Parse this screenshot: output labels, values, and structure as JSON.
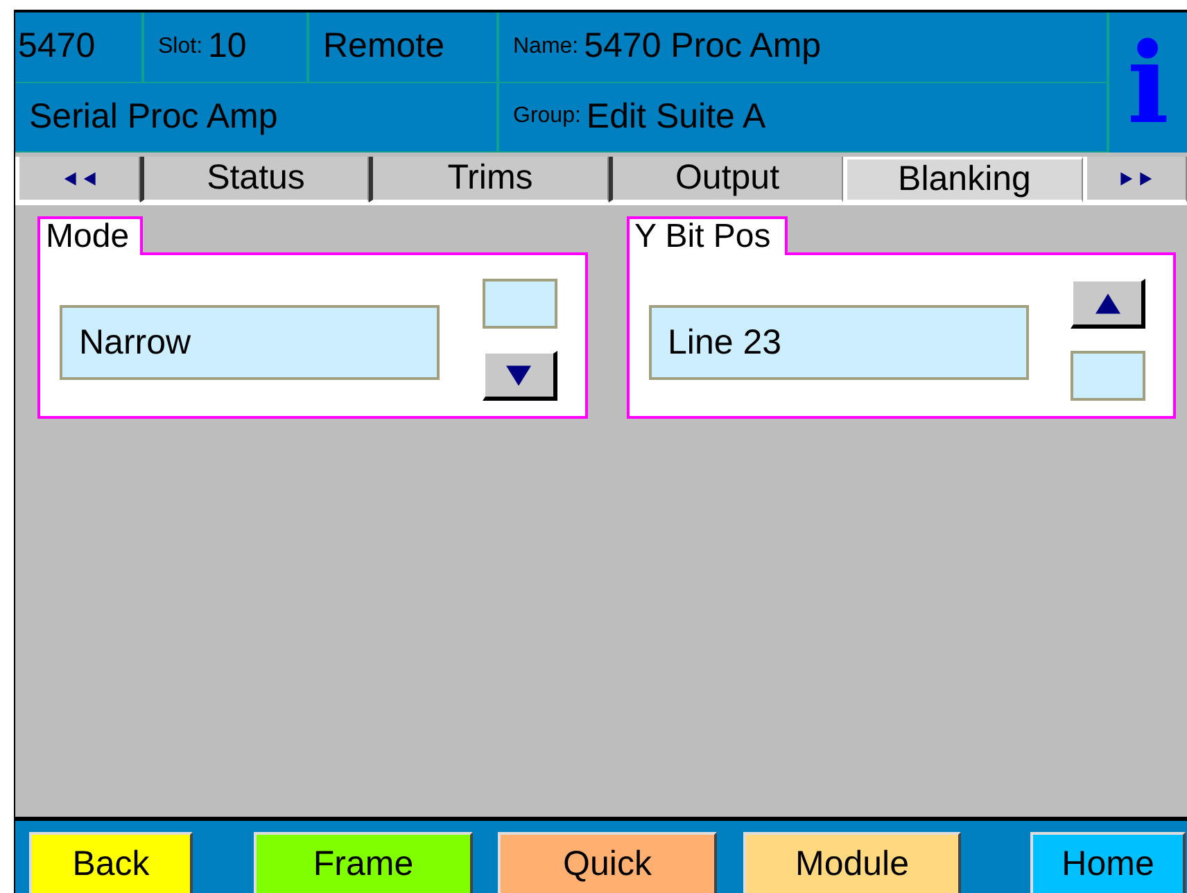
{
  "header": {
    "model": "5470",
    "slot_label": "Slot:",
    "slot": "10",
    "mode": "Remote",
    "name_label": "Name:",
    "name": "5470 Proc Amp",
    "description": "Serial Proc Amp",
    "group_label": "Group:",
    "group": "Edit Suite A",
    "info": "i"
  },
  "tabs": [
    {
      "label": "Status",
      "selected": false
    },
    {
      "label": "Trims",
      "selected": false
    },
    {
      "label": "Output",
      "selected": false
    },
    {
      "label": "Blanking",
      "selected": true
    }
  ],
  "panels": [
    {
      "title": "Mode",
      "value": "Narrow",
      "up_enabled": false,
      "down_enabled": true
    },
    {
      "title": "Y Bit Pos",
      "value": "Line 23",
      "up_enabled": true,
      "down_enabled": false
    }
  ],
  "footer_buttons": [
    {
      "label": "Back",
      "color": "#ffff00"
    },
    {
      "label": "Frame",
      "color": "#80ff00"
    },
    {
      "label": "Quick",
      "color": "#ffb070"
    },
    {
      "label": "Module",
      "color": "#ffd880"
    },
    {
      "label": "Home",
      "color": "#00c0ff"
    }
  ]
}
